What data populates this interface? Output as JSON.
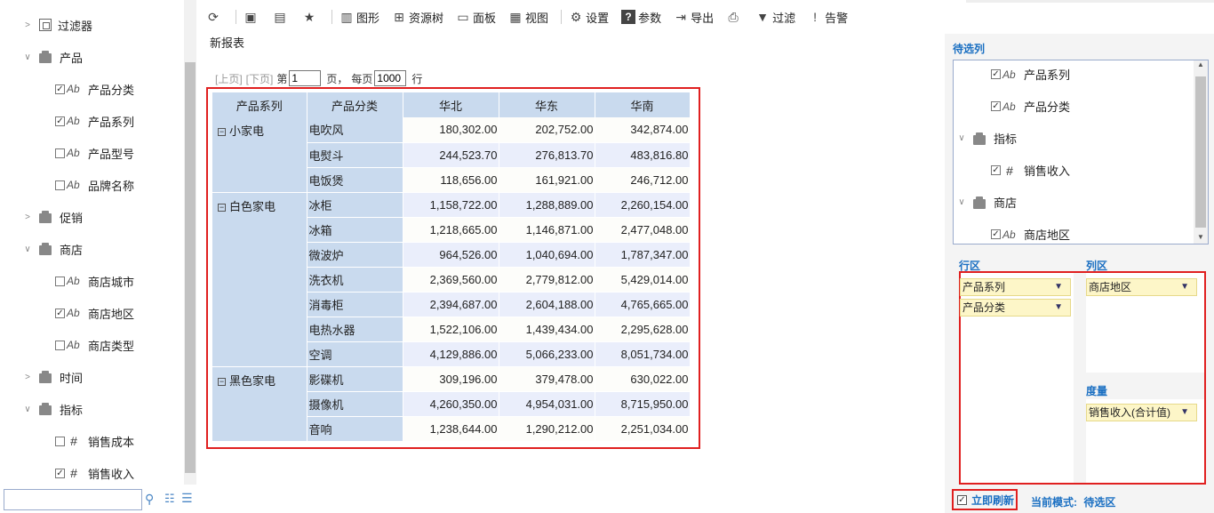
{
  "tree": [
    {
      "kind": "filter",
      "label": "过滤器"
    },
    {
      "kind": "folder",
      "label": "产品",
      "expanded": true
    },
    {
      "kind": "field",
      "type": "Ab",
      "checked": true,
      "label": "产品分类"
    },
    {
      "kind": "field",
      "type": "Ab",
      "checked": true,
      "label": "产品系列"
    },
    {
      "kind": "field",
      "type": "Ab",
      "checked": false,
      "label": "产品型号"
    },
    {
      "kind": "field",
      "type": "Ab",
      "checked": false,
      "label": "品牌名称"
    },
    {
      "kind": "folder",
      "label": "促销",
      "expanded": false
    },
    {
      "kind": "folder",
      "label": "商店",
      "expanded": true
    },
    {
      "kind": "field",
      "type": "Ab",
      "checked": false,
      "label": "商店城市"
    },
    {
      "kind": "field",
      "type": "Ab",
      "checked": true,
      "label": "商店地区"
    },
    {
      "kind": "field",
      "type": "Ab",
      "checked": false,
      "label": "商店类型"
    },
    {
      "kind": "folder",
      "label": "时间",
      "expanded": false
    },
    {
      "kind": "folder",
      "label": "指标",
      "expanded": true
    },
    {
      "kind": "field",
      "type": "#",
      "checked": false,
      "label": "销售成本"
    },
    {
      "kind": "field",
      "type": "#",
      "checked": true,
      "label": "销售收入"
    }
  ],
  "search": {
    "value": "",
    "placeholder": ""
  },
  "toolbar": {
    "items": [
      {
        "icon": "refresh-icon",
        "label": ""
      },
      {
        "icon": "save-icon",
        "label": ""
      },
      {
        "icon": "save-as-icon",
        "label": ""
      },
      {
        "icon": "star-icon",
        "label": ""
      },
      {
        "icon": "chart-icon",
        "label": "图形"
      },
      {
        "icon": "resource-tree-icon",
        "label": "资源树"
      },
      {
        "icon": "panel-icon",
        "label": "面板"
      },
      {
        "icon": "view-icon",
        "label": "视图"
      },
      {
        "icon": "gear-icon",
        "label": "设置"
      },
      {
        "icon": "help-icon",
        "label": "参数"
      },
      {
        "icon": "export-icon",
        "label": "导出"
      },
      {
        "icon": "print-icon",
        "label": ""
      },
      {
        "icon": "filter-icon",
        "label": "过滤"
      },
      {
        "icon": "alert-icon",
        "label": "告警"
      }
    ]
  },
  "report": {
    "name": "新报表"
  },
  "pager": {
    "prev": "[上页]",
    "next": "[下页]",
    "page_prefix": "第",
    "page": "1",
    "page_suffix": "页，",
    "per_page_label": "每页",
    "per_page": "1000",
    "rows_unit": "行"
  },
  "table": {
    "headers": [
      "产品系列",
      "产品分类",
      "华北",
      "华东",
      "华南"
    ],
    "groups": [
      {
        "name": "小家电",
        "rows": [
          [
            "电吹风",
            "180,302.00",
            "202,752.00",
            "342,874.00"
          ],
          [
            "电熨斗",
            "244,523.70",
            "276,813.70",
            "483,816.80"
          ],
          [
            "电饭煲",
            "118,656.00",
            "161,921.00",
            "246,712.00"
          ]
        ]
      },
      {
        "name": "白色家电",
        "rows": [
          [
            "冰柜",
            "1,158,722.00",
            "1,288,889.00",
            "2,260,154.00"
          ],
          [
            "冰箱",
            "1,218,665.00",
            "1,146,871.00",
            "2,477,048.00"
          ],
          [
            "微波炉",
            "964,526.00",
            "1,040,694.00",
            "1,787,347.00"
          ],
          [
            "洗衣机",
            "2,369,560.00",
            "2,779,812.00",
            "5,429,014.00"
          ],
          [
            "消毒柜",
            "2,394,687.00",
            "2,604,188.00",
            "4,765,665.00"
          ],
          [
            "电热水器",
            "1,522,106.00",
            "1,439,434.00",
            "2,295,628.00"
          ],
          [
            "空调",
            "4,129,886.00",
            "5,066,233.00",
            "8,051,734.00"
          ]
        ]
      },
      {
        "name": "黑色家电",
        "rows": [
          [
            "影碟机",
            "309,196.00",
            "379,478.00",
            "630,022.00"
          ],
          [
            "摄像机",
            "4,260,350.00",
            "4,954,031.00",
            "8,715,950.00"
          ],
          [
            "音响",
            "1,238,644.00",
            "1,290,212.00",
            "2,251,034.00"
          ]
        ]
      }
    ]
  },
  "right": {
    "candidates_title": "待选列",
    "candidates": [
      {
        "kind": "field",
        "type": "Ab",
        "checked": true,
        "label": "产品系列"
      },
      {
        "kind": "field",
        "type": "Ab",
        "checked": true,
        "label": "产品分类"
      },
      {
        "kind": "folder",
        "label": "指标"
      },
      {
        "kind": "field",
        "type": "#",
        "checked": true,
        "label": "销售收入"
      },
      {
        "kind": "folder",
        "label": "商店"
      },
      {
        "kind": "field",
        "type": "Ab",
        "checked": true,
        "label": "商店地区"
      }
    ],
    "row_zone_title": "行区",
    "col_zone_title": "列区",
    "measure_zone_title": "度量",
    "row_items": [
      "产品系列",
      "产品分类"
    ],
    "col_items": [
      "商店地区"
    ],
    "measure_items": [
      "销售收入(合计值)"
    ],
    "refresh_label": "立即刷新",
    "refresh_checked": true,
    "mode_label": "当前模式:",
    "mode_value": "待选区"
  }
}
